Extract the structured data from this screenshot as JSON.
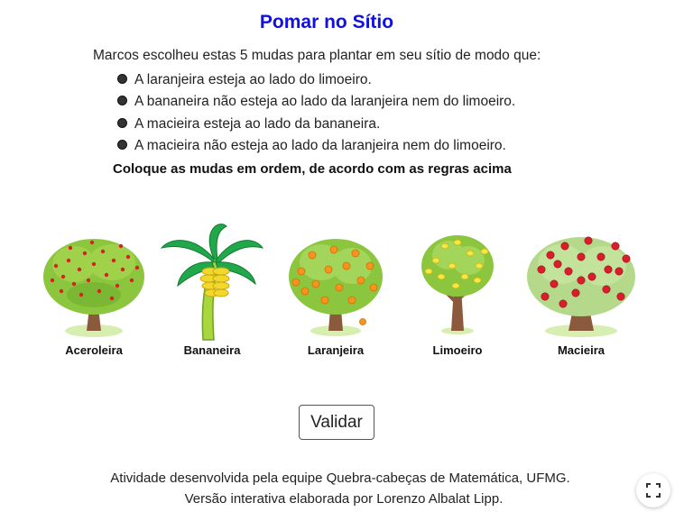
{
  "title": "Pomar no Sítio",
  "intro": "Marcos escolheu estas 5 mudas para plantar em seu sítio de modo que:",
  "rules": [
    "A laranjeira esteja ao lado do limoeiro.",
    "A bananeira não esteja ao lado da laranjeira nem do limoeiro.",
    "A macieira esteja ao lado da bananeira.",
    "A macieira não esteja ao lado da laranjeira nem do limoeiro."
  ],
  "instruction": "Coloque as mudas em ordem, de acordo com as regras acima",
  "trees": [
    {
      "label": "Aceroleira",
      "icon": "acerola-tree-icon"
    },
    {
      "label": "Bananeira",
      "icon": "banana-tree-icon"
    },
    {
      "label": "Laranjeira",
      "icon": "orange-tree-icon"
    },
    {
      "label": "Limoeiro",
      "icon": "lemon-tree-icon"
    },
    {
      "label": "Macieira",
      "icon": "apple-tree-icon"
    }
  ],
  "validate_label": "Validar",
  "footer": {
    "line1": "Atividade desenvolvida pela equipe Quebra-cabeças de Matemática, UFMG.",
    "line2": "Versão interativa elaborada por Lorenzo Albalat Lipp."
  },
  "fullscreen_icon": "fullscreen-icon",
  "colors": {
    "title": "#1010e0",
    "foliage": "#8cc63f",
    "trunk": "#8b5a3c",
    "acerola": "#d92020",
    "orange": "#f7941d",
    "lemon": "#f5e64a",
    "banana": "#f2d72c"
  }
}
